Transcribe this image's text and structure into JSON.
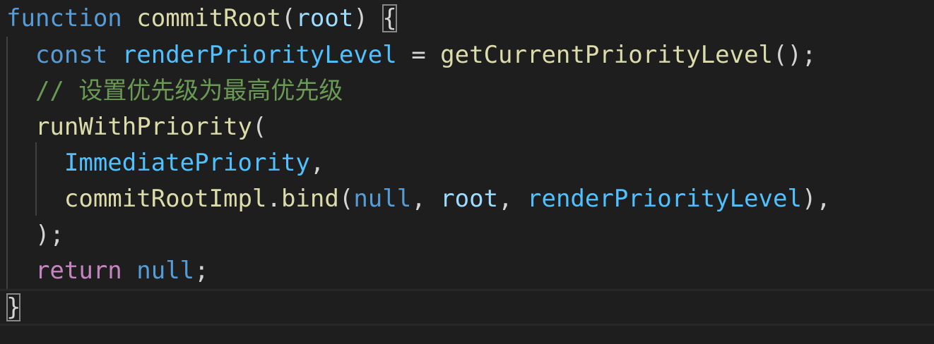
{
  "editor": {
    "language": "javascript",
    "theme_colors": {
      "background": "#1e1e1e",
      "keyword": "#569cd6",
      "function": "#dcdcaa",
      "variable": "#9cdcfe",
      "constant": "#4fc1ff",
      "comment": "#6a9955",
      "control": "#c586c0",
      "punctuation": "#d4d4d4"
    },
    "lines": [
      {
        "tokens": [
          {
            "t": "function",
            "c": "kw"
          },
          {
            "t": " ",
            "c": "pun"
          },
          {
            "t": "commitRoot",
            "c": "fn"
          },
          {
            "t": "(",
            "c": "pun"
          },
          {
            "t": "root",
            "c": "var"
          },
          {
            "t": ") ",
            "c": "pun"
          },
          {
            "t": "{",
            "c": "pun",
            "boxed": true
          }
        ]
      },
      {
        "tokens": [
          {
            "t": "  ",
            "c": "pun"
          },
          {
            "t": "const",
            "c": "kw"
          },
          {
            "t": " ",
            "c": "pun"
          },
          {
            "t": "renderPriorityLevel",
            "c": "const"
          },
          {
            "t": " = ",
            "c": "pun"
          },
          {
            "t": "getCurrentPriorityLevel",
            "c": "fn"
          },
          {
            "t": "();",
            "c": "pun"
          }
        ]
      },
      {
        "tokens": [
          {
            "t": "  ",
            "c": "pun"
          },
          {
            "t": "// 设置优先级为最高优先级",
            "c": "com"
          }
        ]
      },
      {
        "tokens": [
          {
            "t": "  ",
            "c": "pun"
          },
          {
            "t": "runWithPriority",
            "c": "fn"
          },
          {
            "t": "(",
            "c": "pun"
          }
        ]
      },
      {
        "tokens": [
          {
            "t": "    ",
            "c": "pun"
          },
          {
            "t": "ImmediatePriority",
            "c": "const"
          },
          {
            "t": ",",
            "c": "pun"
          }
        ]
      },
      {
        "tokens": [
          {
            "t": "    ",
            "c": "pun"
          },
          {
            "t": "commitRootImpl",
            "c": "fn"
          },
          {
            "t": ".",
            "c": "pun"
          },
          {
            "t": "bind",
            "c": "fn"
          },
          {
            "t": "(",
            "c": "pun"
          },
          {
            "t": "null",
            "c": "kw"
          },
          {
            "t": ", ",
            "c": "pun"
          },
          {
            "t": "root",
            "c": "var"
          },
          {
            "t": ", ",
            "c": "pun"
          },
          {
            "t": "renderPriorityLevel",
            "c": "const"
          },
          {
            "t": "),",
            "c": "pun"
          }
        ]
      },
      {
        "tokens": [
          {
            "t": "  ",
            "c": "pun"
          },
          {
            "t": ");",
            "c": "pun"
          }
        ]
      },
      {
        "tokens": [
          {
            "t": "  ",
            "c": "pun"
          },
          {
            "t": "return",
            "c": "ctrl"
          },
          {
            "t": " ",
            "c": "pun"
          },
          {
            "t": "null",
            "c": "kw"
          },
          {
            "t": ";",
            "c": "pun"
          }
        ]
      },
      {
        "tokens": [
          {
            "t": "}",
            "c": "pun",
            "boxed": true
          }
        ]
      }
    ]
  }
}
